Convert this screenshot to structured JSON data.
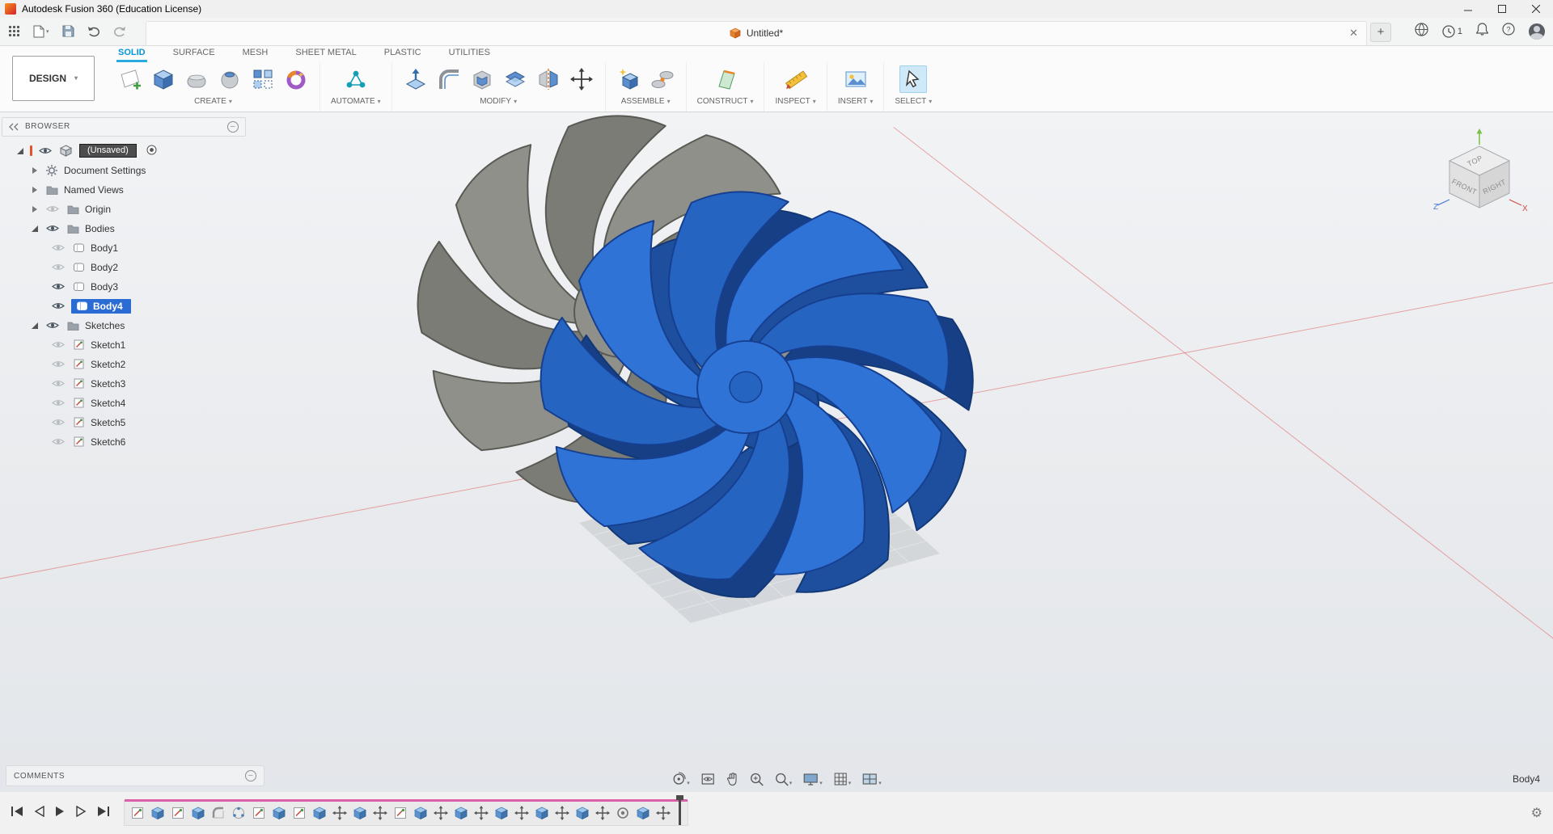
{
  "window": {
    "title": "Autodesk Fusion 360 (Education License)"
  },
  "tabbar": {
    "tab_title": "Untitled*",
    "notification_count": "1"
  },
  "ribbon": {
    "workspace_label": "DESIGN",
    "tabs": [
      {
        "label": "SOLID",
        "active": true
      },
      {
        "label": "SURFACE"
      },
      {
        "label": "MESH"
      },
      {
        "label": "SHEET METAL"
      },
      {
        "label": "PLASTIC"
      },
      {
        "label": "UTILITIES"
      }
    ],
    "groups": [
      {
        "label": "CREATE"
      },
      {
        "label": "AUTOMATE"
      },
      {
        "label": "MODIFY"
      },
      {
        "label": "ASSEMBLE"
      },
      {
        "label": "CONSTRUCT"
      },
      {
        "label": "INSPECT"
      },
      {
        "label": "INSERT"
      },
      {
        "label": "SELECT"
      }
    ]
  },
  "browser": {
    "header": "BROWSER",
    "root_label": "(Unsaved)",
    "items": [
      {
        "label": "Document Settings"
      },
      {
        "label": "Named Views"
      },
      {
        "label": "Origin"
      },
      {
        "label": "Bodies"
      },
      {
        "label": "Body1"
      },
      {
        "label": "Body2"
      },
      {
        "label": "Body3"
      },
      {
        "label": "Body4",
        "selected": true
      },
      {
        "label": "Sketches"
      },
      {
        "label": "Sketch1"
      },
      {
        "label": "Sketch2"
      },
      {
        "label": "Sketch3"
      },
      {
        "label": "Sketch4"
      },
      {
        "label": "Sketch5"
      },
      {
        "label": "Sketch6"
      }
    ]
  },
  "viewcube": {
    "top": "TOP",
    "front": "FRONT",
    "right": "RIGHT",
    "x": "X",
    "z": "Z"
  },
  "comments": {
    "label": "COMMENTS"
  },
  "statusbar": {
    "selected_body": "Body4"
  },
  "timeline": {
    "features": [
      "sketch",
      "extrude",
      "sketch",
      "extrude",
      "fillet",
      "pattern",
      "sketch",
      "extrude",
      "sketch",
      "extrude",
      "move",
      "extrude",
      "move",
      "sketch",
      "extrude",
      "move",
      "extrude",
      "move",
      "extrude",
      "move",
      "extrude",
      "move",
      "extrude",
      "move",
      "hole",
      "extrude",
      "move"
    ]
  },
  "colors": {
    "accent": "#0696d7",
    "selection_blue": "#2b6cd4",
    "body_blue": "#2f73d6",
    "body_gray": "#8f9089",
    "axis_red": "#df5656",
    "timeline_scrubber": "#dd5fa8"
  }
}
